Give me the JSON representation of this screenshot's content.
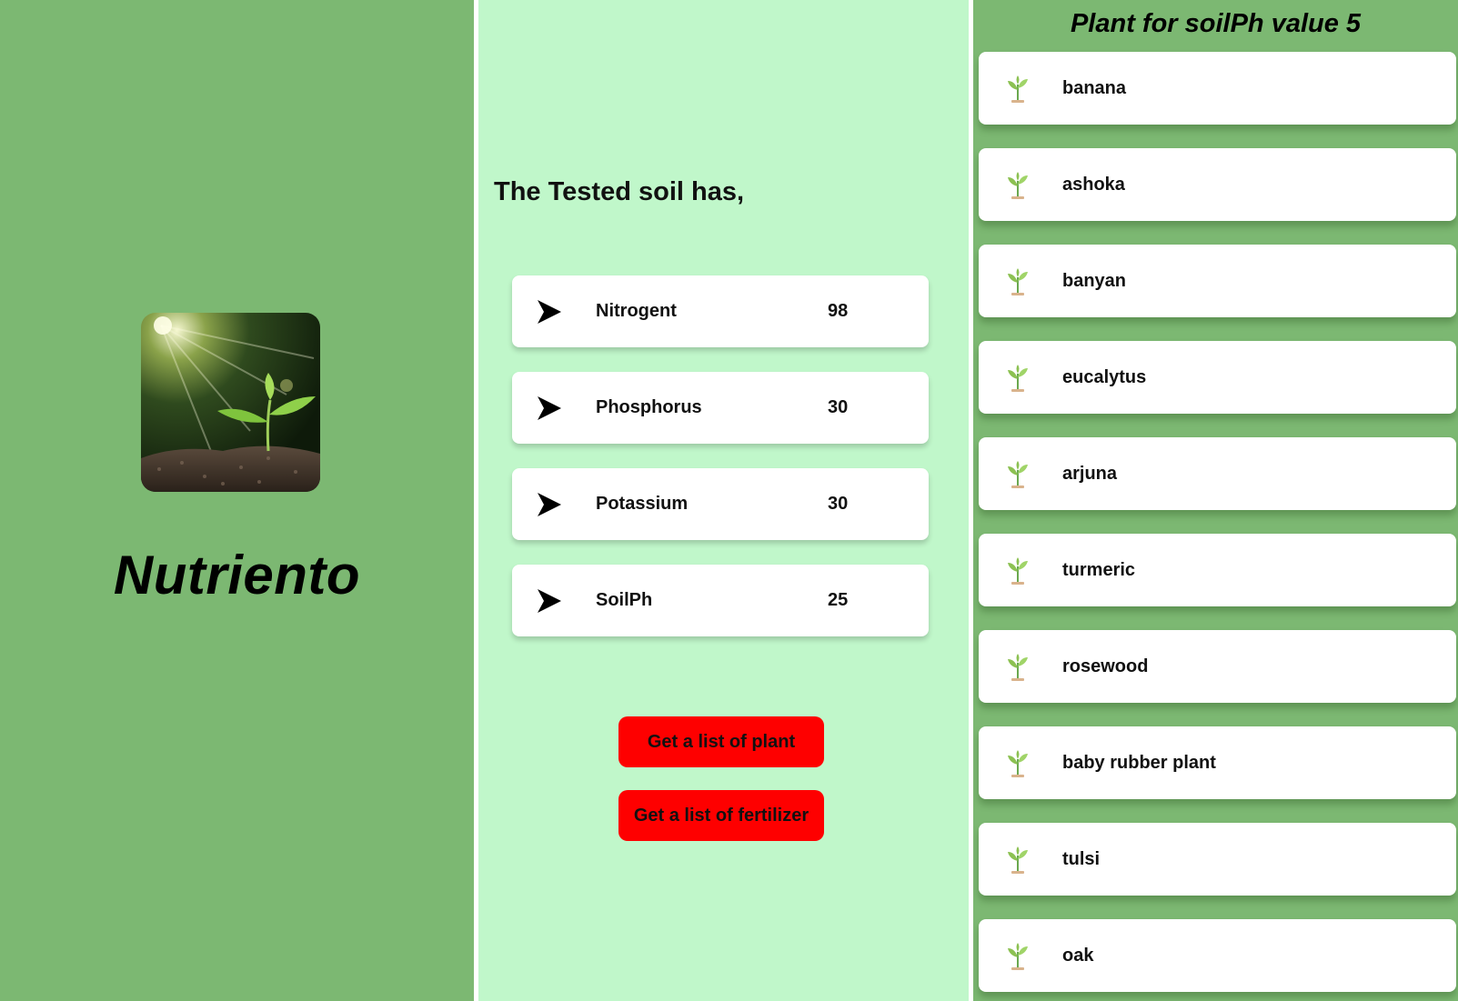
{
  "app": {
    "name": "Nutriento",
    "logo_icon": "seedling-in-soil-photo"
  },
  "soil": {
    "heading": "The Tested soil has,",
    "nutrients": [
      {
        "label": "Nitrogent",
        "value": "98",
        "icon": "arrow-right-icon"
      },
      {
        "label": "Phosphorus",
        "value": "30",
        "icon": "arrow-right-icon"
      },
      {
        "label": "Potassium",
        "value": "30",
        "icon": "arrow-right-icon"
      },
      {
        "label": "SoilPh",
        "value": "25",
        "icon": "arrow-right-icon"
      }
    ],
    "buttons": {
      "plants_label": "Get a list of plant",
      "fertilizer_label": "Get a list of fertilizer"
    }
  },
  "plants": {
    "title": "Plant for soilPh value 5",
    "icon": "sprout-icon",
    "items": [
      {
        "name": "banana"
      },
      {
        "name": "ashoka"
      },
      {
        "name": "banyan"
      },
      {
        "name": "eucalytus"
      },
      {
        "name": "arjuna"
      },
      {
        "name": "turmeric"
      },
      {
        "name": "rosewood"
      },
      {
        "name": "baby rubber plant"
      },
      {
        "name": "tulsi"
      },
      {
        "name": "oak"
      }
    ]
  },
  "colors": {
    "panel_green": "#7cb872",
    "panel_mint": "#c0f7ca",
    "button_red": "#fe0000",
    "card_white": "#ffffff"
  }
}
